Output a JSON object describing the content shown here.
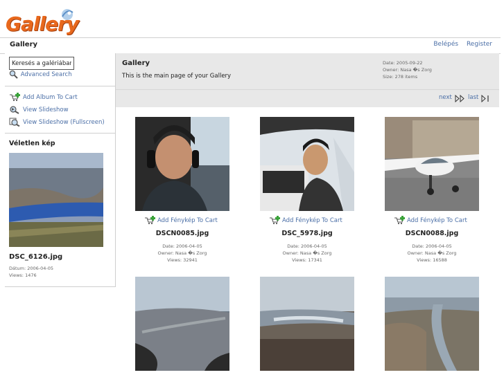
{
  "app": {
    "logo_text": "Gallery"
  },
  "navbar": {
    "crumb": "Gallery",
    "login": "Belépés",
    "register": "Register"
  },
  "sidebar": {
    "search_value": "Keresés a galériában",
    "advanced_search": "Advanced Search",
    "items": [
      {
        "label": "Add Album To Cart",
        "icon": "cart-add-icon"
      },
      {
        "label": "View Slideshow",
        "icon": "slideshow-icon"
      },
      {
        "label": "View Slideshow (Fullscreen)",
        "icon": "slideshow-fullscreen-icon"
      }
    ],
    "random_title": "Véletlen kép",
    "random_name": "DSC_6126.jpg",
    "random_date": "Dátum: 2006-04-05",
    "random_views": "Views: 1476"
  },
  "header": {
    "title": "Gallery",
    "description": "This is the main page of your Gallery",
    "date": "Date: 2005-09-22",
    "owner": "Owner: Nasa �s Zorg",
    "size": "Size: 278 items"
  },
  "pager": {
    "next": "next",
    "last": "last"
  },
  "photos": [
    {
      "cart": "Add Fénykép To Cart",
      "name": "DSCN0085.jpg",
      "date": "Date: 2006-04-05",
      "owner": "Owner: Nasa �s Zorg",
      "views": "Views: 32941"
    },
    {
      "cart": "Add Fénykép To Cart",
      "name": "DSC_5978.jpg",
      "date": "Date: 2006-04-05",
      "owner": "Owner: Nasa �s Zorg",
      "views": "Views: 17341"
    },
    {
      "cart": "Add Fénykép To Cart",
      "name": "DSCN0088.jpg",
      "date": "Date: 2006-04-05",
      "owner": "Owner: Nasa �s Zorg",
      "views": "Views: 16588"
    }
  ],
  "colors": {
    "link": "#4a6ea6",
    "header_bg": "#e8e8e8",
    "logo": "#e8681c"
  }
}
